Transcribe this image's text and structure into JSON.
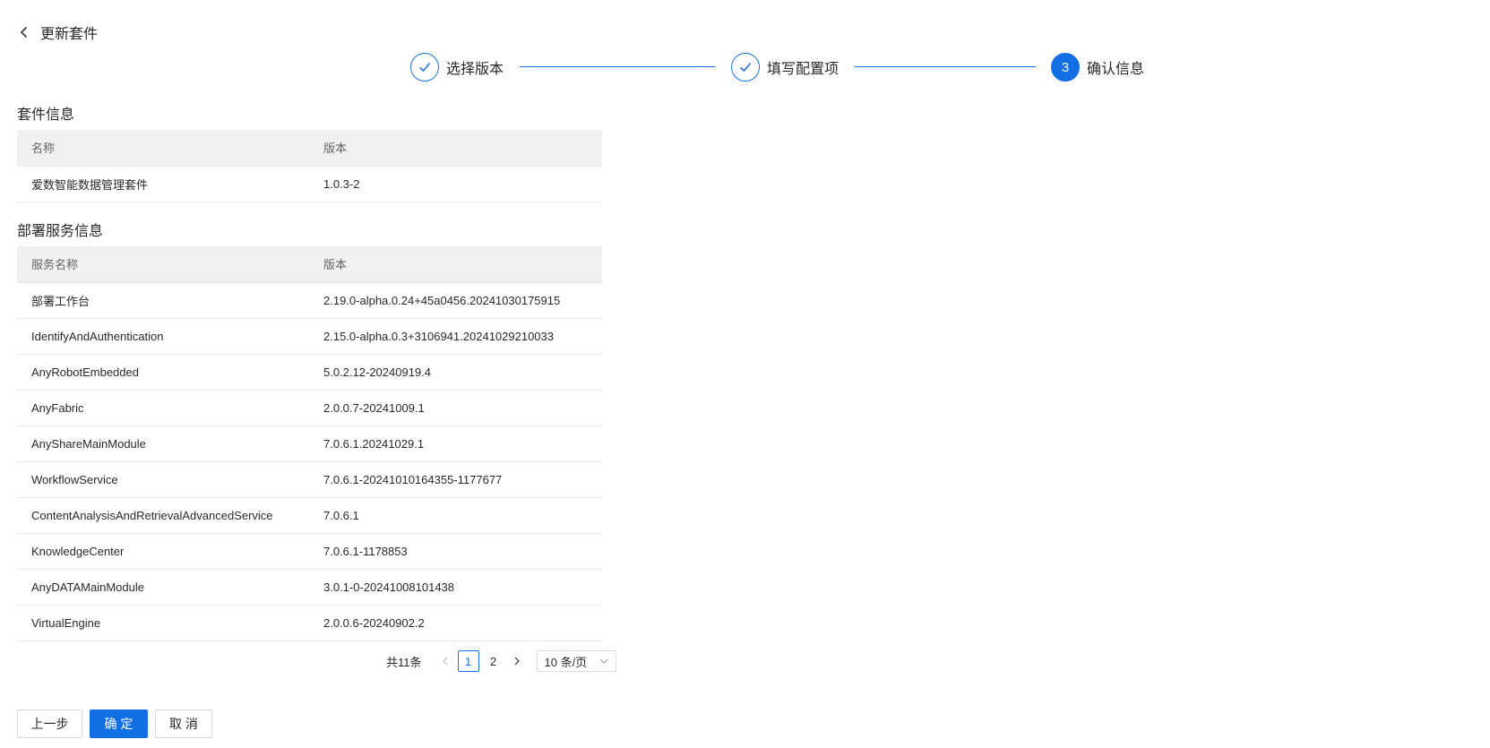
{
  "header": {
    "title": "更新套件"
  },
  "steps": [
    {
      "label": "选择版本",
      "status": "done"
    },
    {
      "label": "填写配置项",
      "status": "done"
    },
    {
      "label": "确认信息",
      "status": "active",
      "number": "3"
    }
  ],
  "suite_section": {
    "title": "套件信息",
    "columns": [
      "名称",
      "版本"
    ],
    "rows": [
      {
        "name": "爱数智能数据管理套件",
        "version": "1.0.3-2"
      }
    ]
  },
  "service_section": {
    "title": "部署服务信息",
    "columns": [
      "服务名称",
      "版本"
    ],
    "rows": [
      {
        "name": "部署工作台",
        "version": "2.19.0-alpha.0.24+45a0456.20241030175915"
      },
      {
        "name": "IdentifyAndAuthentication",
        "version": "2.15.0-alpha.0.3+3106941.20241029210033"
      },
      {
        "name": "AnyRobotEmbedded",
        "version": "5.0.2.12-20240919.4"
      },
      {
        "name": "AnyFabric",
        "version": "2.0.0.7-20241009.1"
      },
      {
        "name": "AnyShareMainModule",
        "version": "7.0.6.1.20241029.1"
      },
      {
        "name": "WorkflowService",
        "version": "7.0.6.1-20241010164355-1177677"
      },
      {
        "name": "ContentAnalysisAndRetrievalAdvancedService",
        "version": "7.0.6.1"
      },
      {
        "name": "KnowledgeCenter",
        "version": "7.0.6.1-1178853"
      },
      {
        "name": "AnyDATAMainModule",
        "version": "3.0.1-0-20241008101438"
      },
      {
        "name": "VirtualEngine",
        "version": "2.0.0.6-20240902.2"
      }
    ]
  },
  "pagination": {
    "total_label": "共11条",
    "pages": [
      "1",
      "2"
    ],
    "current_page": "1",
    "page_size_label": "10 条/页"
  },
  "footer": {
    "prev_label": "上一步",
    "confirm_label": "确 定",
    "cancel_label": "取 消"
  },
  "colors": {
    "primary": "#126ee3",
    "step_line": "#1a73e8",
    "table_header_bg": "#f0f0f0"
  },
  "icons": [
    "back-arrow-icon",
    "check-icon",
    "chevron-left-icon",
    "chevron-right-icon",
    "chevron-down-icon"
  ]
}
